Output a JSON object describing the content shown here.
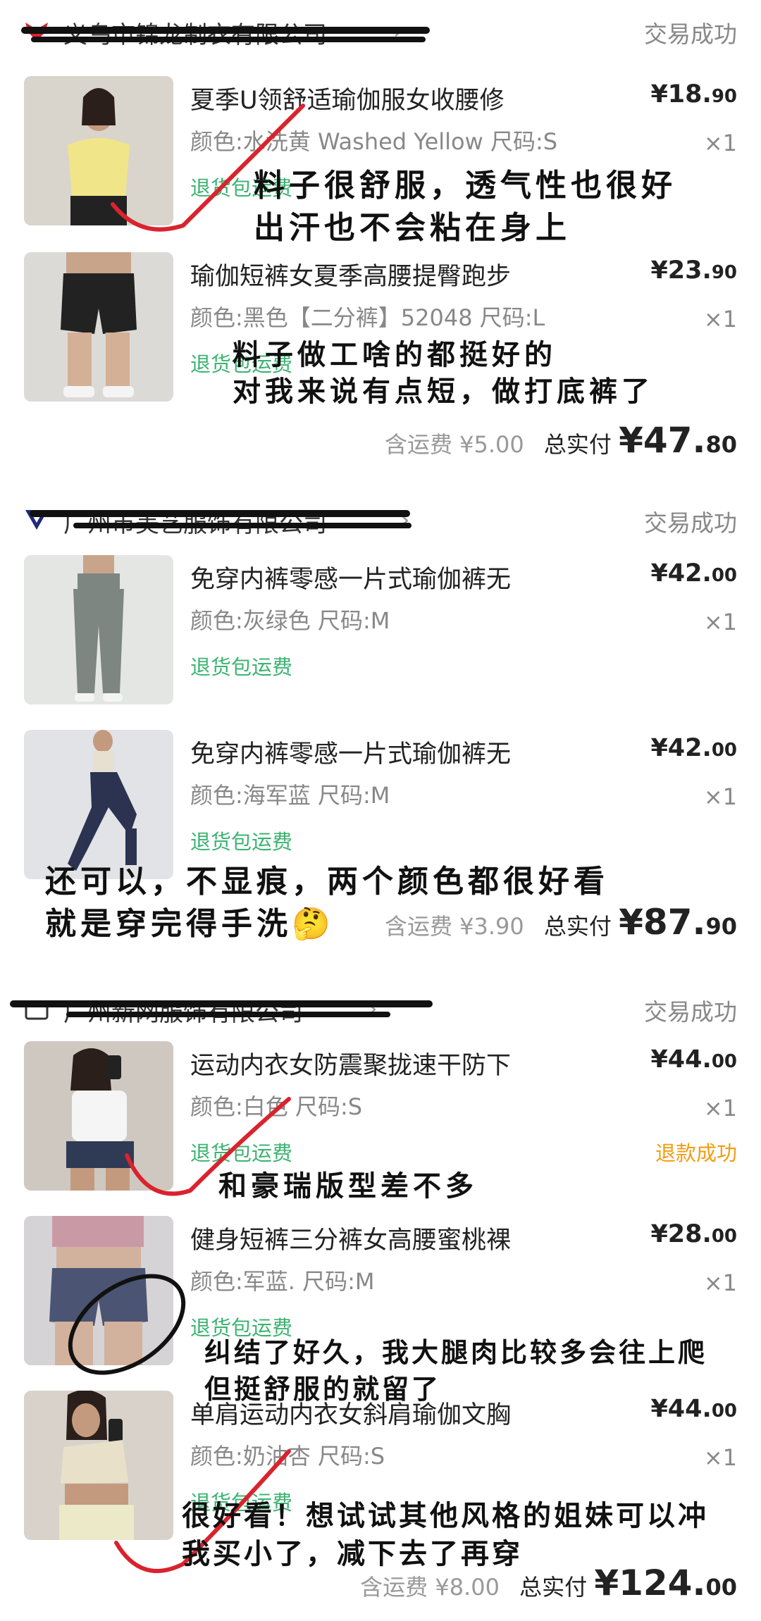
{
  "orders": [
    {
      "store_name": "义乌市锦龙制衣有限公司",
      "status": "交易成功",
      "items": [
        {
          "title": "夏季U领舒适瑜伽服女收腰修",
          "price_int": "¥18.",
          "price_dec": "90",
          "spec": "颜色:水洗黄 Washed Yellow 尺码:S",
          "qty": "×1",
          "return_tag": "退货包运费",
          "bg": "#d9d4cc",
          "accent": "#f1e58a"
        },
        {
          "title": "瑜伽短裤女夏季高腰提臀跑步",
          "price_int": "¥23.",
          "price_dec": "90",
          "spec": "颜色:黑色【二分裤】52048 尺码:L",
          "qty": "×1",
          "return_tag": "退货包运费",
          "bg": "#dcdad6",
          "accent": "#222222"
        }
      ],
      "shipping": "含运费 ¥5.00",
      "total_label": "总实付",
      "total_int": "¥47.",
      "total_dec": "80"
    },
    {
      "store_name": "广州市美艺服饰有限公司",
      "status": "交易成功",
      "items": [
        {
          "title": "免穿内裤零感一片式瑜伽裤无",
          "price_int": "¥42.",
          "price_dec": "00",
          "spec": "颜色:灰绿色 尺码:M",
          "qty": "×1",
          "return_tag": "退货包运费",
          "bg": "#e4e6e4",
          "accent": "#7d8680"
        },
        {
          "title": "免穿内裤零感一片式瑜伽裤无",
          "price_int": "¥42.",
          "price_dec": "00",
          "spec": "颜色:海军蓝 尺码:M",
          "qty": "×1",
          "return_tag": "退货包运费",
          "bg": "#e2e3e6",
          "accent": "#2b3350"
        }
      ],
      "shipping": "含运费 ¥3.90",
      "total_label": "总实付",
      "total_int": "¥87.",
      "total_dec": "90"
    },
    {
      "store_name": "广州新网服饰有限公司",
      "status": "交易成功",
      "items": [
        {
          "title": "运动内衣女防震聚拢速干防下",
          "price_int": "¥44.",
          "price_dec": "00",
          "spec": "颜色:白色 尺码:S",
          "qty": "×1",
          "return_tag": "退货包运费",
          "refund": "退款成功",
          "bg": "#cfc8c0",
          "accent": "#2f3a55"
        },
        {
          "title": "健身短裤三分裤女高腰蜜桃裸",
          "price_int": "¥28.",
          "price_dec": "00",
          "spec": "颜色:军蓝. 尺码:M",
          "qty": "×1",
          "return_tag": "退货包运费",
          "bg": "#d6d3d6",
          "accent": "#4b5573"
        },
        {
          "title": "单肩运动内衣女斜肩瑜伽文胸",
          "price_int": "¥44.",
          "price_dec": "00",
          "spec": "颜色:奶油杏 尺码:S",
          "qty": "×1",
          "return_tag": "退货包运费",
          "bg": "#d8d2ca",
          "accent": "#e8e0c8"
        }
      ],
      "shipping": "含运费 ¥8.00",
      "total_label": "总实付",
      "total_int": "¥124.",
      "total_dec": "00"
    }
  ],
  "notes": {
    "n1": "料子很舒服，透气性也很好",
    "n2": "出汗也不会粘在身上",
    "n3": "料子做工啥的都挺好的",
    "n4": "对我来说有点短，做打底裤了",
    "n5": "还可以，不显痕，两个颜色都很好看",
    "n6": "就是穿完得手洗🤔",
    "n7": "和豪瑞版型差不多",
    "n8": "纠结了好久，我大腿肉比较多会往上爬",
    "n9": "但挺舒服的就留了",
    "n10": "很好看！想试试其他风格的姐妹可以冲",
    "n11": "我买小了，减下去了再穿"
  },
  "colors": {
    "green": "#3cb371",
    "orange": "#f39c12",
    "red": "#d9232d",
    "ink": "#111111"
  }
}
